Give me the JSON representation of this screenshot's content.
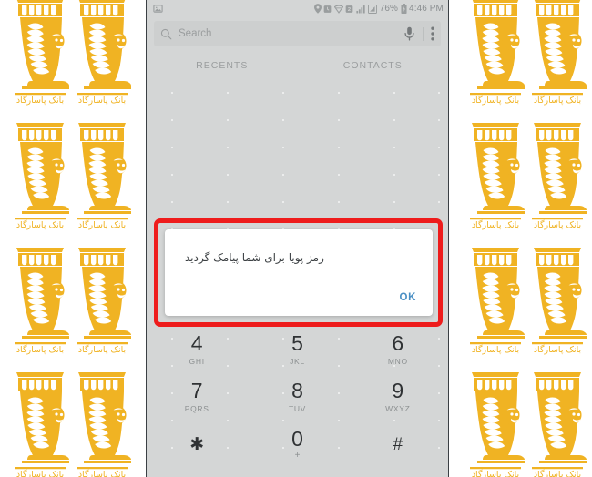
{
  "colors": {
    "watermark_gold": "#F0B323",
    "annotation_red": "#EE1C1C",
    "phone_background": "#D4D6D6",
    "ok_button_blue": "#4A8FC4",
    "dialog_background": "#FFFFFF"
  },
  "watermark": {
    "logo_name": "bank-pasargad-lion-logo",
    "caption": "بانک پاسارگاد"
  },
  "phone": {
    "status_bar": {
      "icons_left": [
        "image-icon"
      ],
      "icons_right": [
        "location-pin-icon",
        "alarm-icon",
        "wifi-icon",
        "sim-2-icon",
        "signal-bars-icon",
        "signal-secondary-icon"
      ],
      "battery_percent": "76%",
      "battery_icon": "battery-charging-icon",
      "time": "4:46 PM"
    },
    "search": {
      "search_icon": "search-icon",
      "placeholder": "Search",
      "mic_icon": "microphone-icon",
      "overflow_icon": "more-vertical-icon"
    },
    "tabs": [
      {
        "label": "RECENTS"
      },
      {
        "label": "CONTACTS"
      }
    ],
    "keypad": {
      "rows": [
        [
          {
            "digit": "4",
            "letters": "GHI",
            "sub": ""
          },
          {
            "digit": "5",
            "letters": "JKL",
            "sub": ""
          },
          {
            "digit": "6",
            "letters": "MNO",
            "sub": ""
          }
        ],
        [
          {
            "digit": "7",
            "letters": "PQRS",
            "sub": ""
          },
          {
            "digit": "8",
            "letters": "TUV",
            "sub": ""
          },
          {
            "digit": "9",
            "letters": "WXYZ",
            "sub": ""
          }
        ],
        [
          {
            "digit": "✱",
            "letters": "",
            "sub": ""
          },
          {
            "digit": "0",
            "letters": "",
            "sub": "+"
          },
          {
            "digit": "#",
            "letters": "",
            "sub": ""
          }
        ]
      ]
    }
  },
  "dialog": {
    "message": "رمز پویا برای شما پیامک گردید",
    "ok_label": "OK"
  }
}
